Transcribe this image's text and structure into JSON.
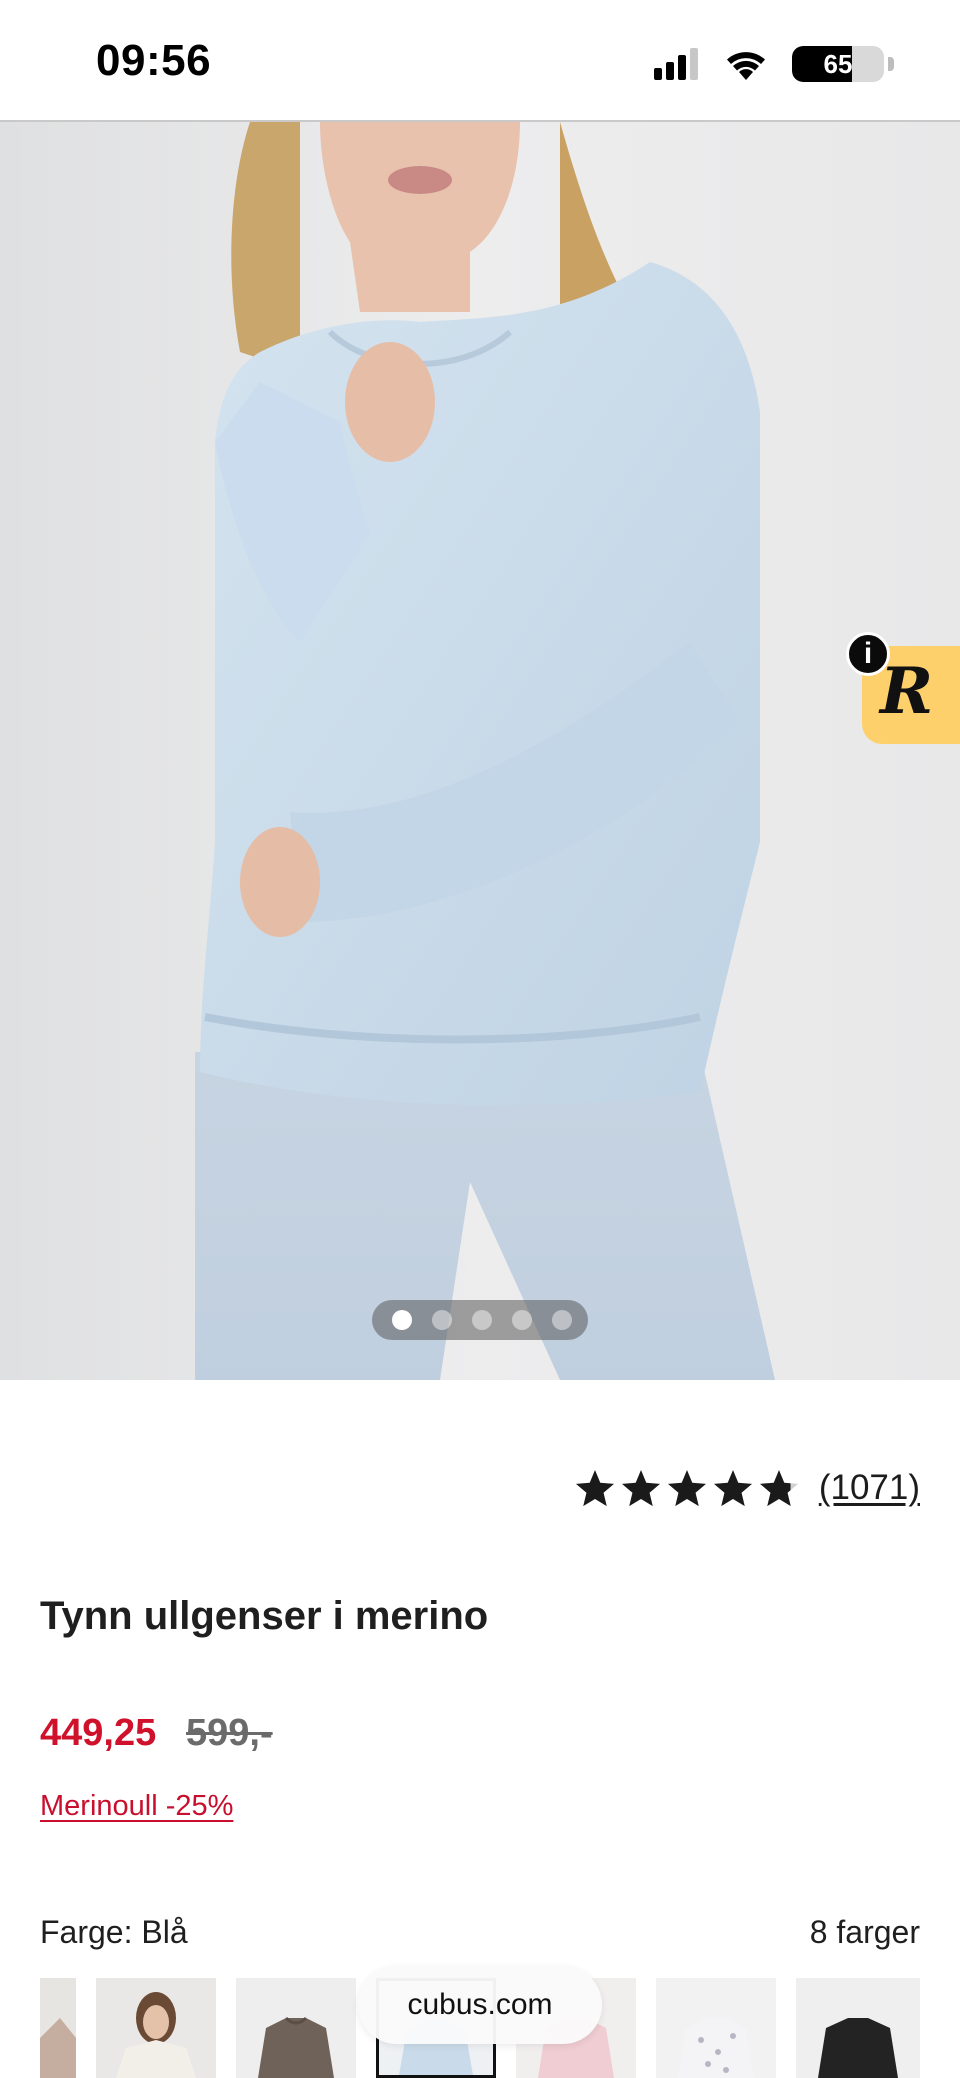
{
  "status_bar": {
    "time": "09:56",
    "battery_level": "65",
    "battery_fraction": 0.65,
    "icons": [
      "signal-bars-icon",
      "wifi-icon",
      "battery-icon"
    ]
  },
  "gallery": {
    "image_alt": "Woman wearing light blue thin long-sleeve wool top and matching leggings",
    "dot_count": 5,
    "active_index": 0
  },
  "reviews_widget": {
    "logo_letter": "R",
    "info_letter": "i",
    "color": "#fdd06b"
  },
  "product": {
    "rating": 4.8,
    "rating_max": 5,
    "review_count": "(1071)",
    "title": "Tynn ullgenser i merino",
    "price_sale": "449,25",
    "price_original": "599,-",
    "campaign_link": "Merinoull -25%",
    "color_label": "Farge: Blå",
    "color_count": "8 farger"
  },
  "colors": {
    "sale_price": "#d0112b",
    "accent_yellow": "#fdd06b",
    "garment_blue": "#c9dbea"
  },
  "browser": {
    "url": "cubus.com"
  }
}
